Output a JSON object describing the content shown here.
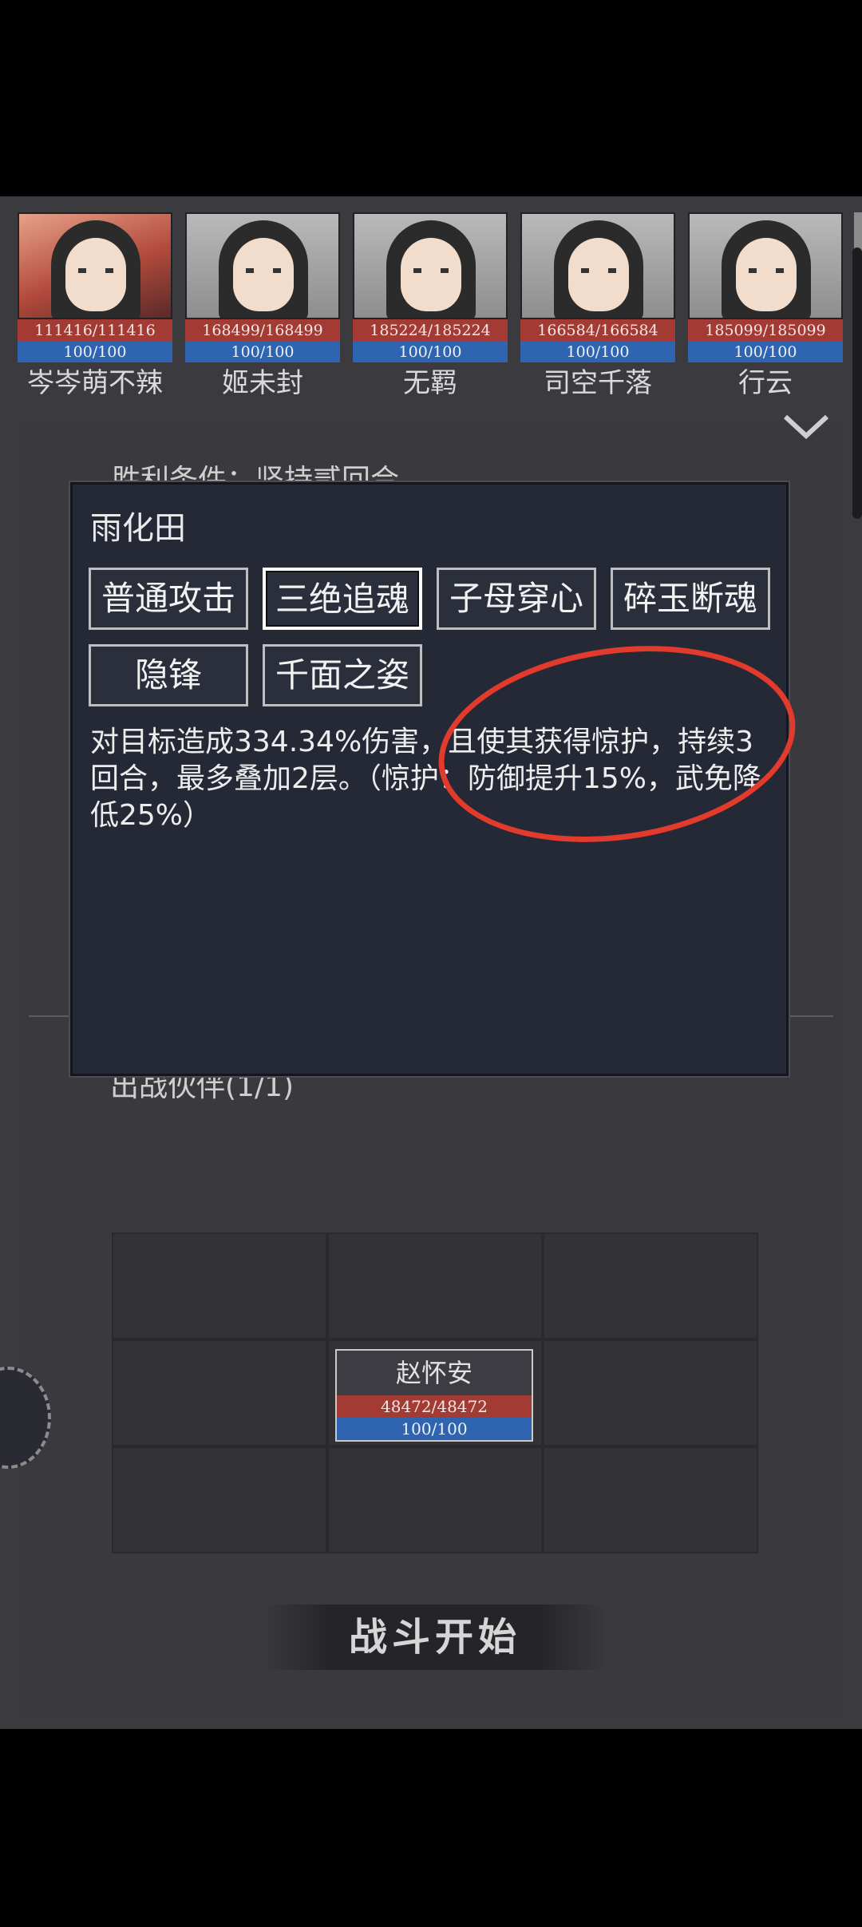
{
  "roster": [
    {
      "name": "岑岑萌不辣",
      "hp": "111416/111416",
      "mp": "100/100"
    },
    {
      "name": "姬未封",
      "hp": "168499/168499",
      "mp": "100/100"
    },
    {
      "name": "无羁",
      "hp": "185224/185224",
      "mp": "100/100"
    },
    {
      "name": "司空千落",
      "hp": "166584/166584",
      "mp": "100/100"
    },
    {
      "name": "行云",
      "hp": "185099/185099",
      "mp": "100/100"
    }
  ],
  "victory_condition": "胜利条件：坚持贰回合",
  "deploy_title": "出战伙伴(1/1)",
  "popup": {
    "title": "雨化田",
    "skills": [
      "普通攻击",
      "三绝追魂",
      "子母穿心",
      "碎玉断魂",
      "隐锋",
      "千面之姿"
    ],
    "selected": "三绝追魂",
    "description": "对目标造成334.34%伤害，且使其获得惊护，持续3回合，最多叠加2层。（惊护：防御提升15%，武免降低25%）"
  },
  "formation": {
    "unit": {
      "name": "赵怀安",
      "hp": "48472/48472",
      "mp": "100/100"
    }
  },
  "start_button": "战斗开始",
  "colors": {
    "hp": "#a33b34",
    "mp": "#2f64b1",
    "highlight": "#e23a2c"
  }
}
